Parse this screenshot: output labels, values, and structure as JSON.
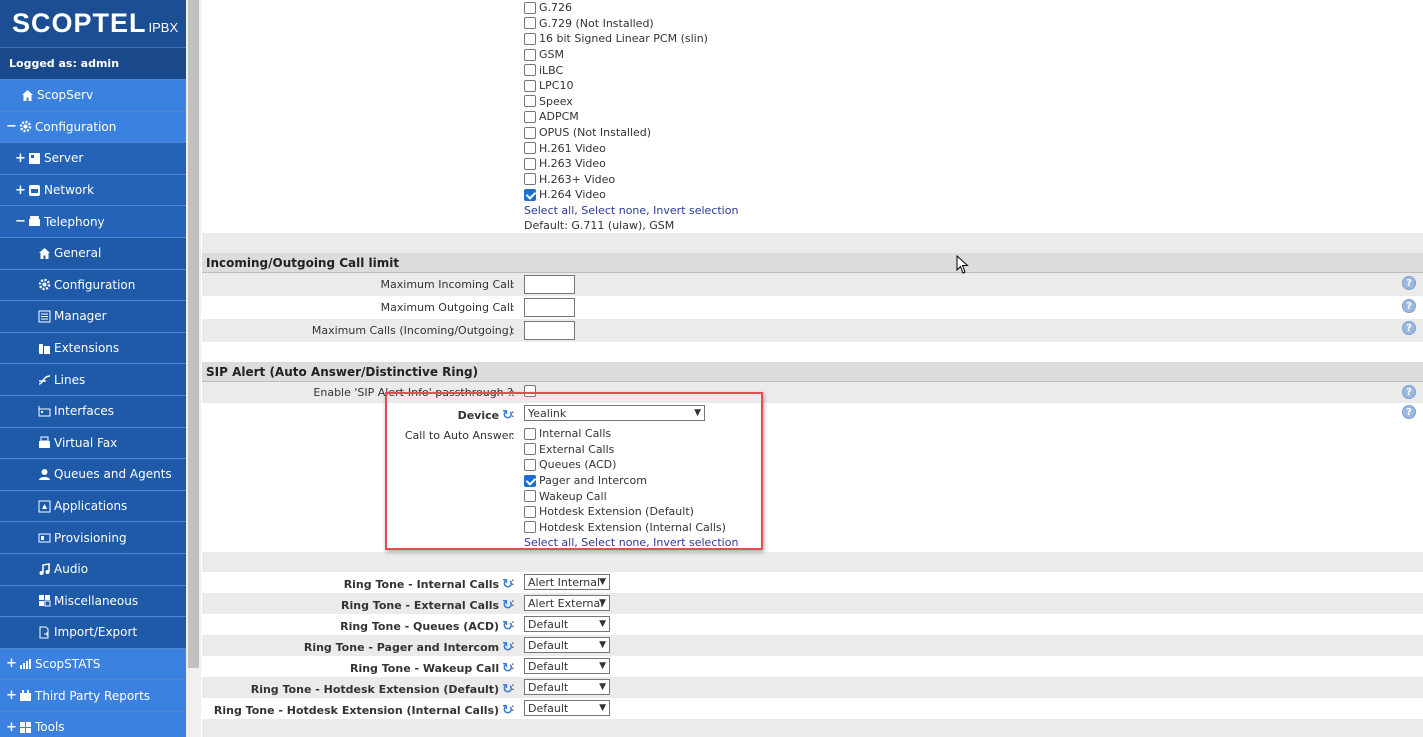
{
  "brand": {
    "logo": "SCOPTEL",
    "suffix": "IPBX"
  },
  "logged_as": "Logged as: admin",
  "nav": {
    "scopserv": "ScopServ",
    "configuration": "Configuration",
    "server": "Server",
    "network": "Network",
    "telephony": "Telephony",
    "general": "General",
    "configuration2": "Configuration",
    "manager": "Manager",
    "extensions": "Extensions",
    "lines": "Lines",
    "interfaces": "Interfaces",
    "virtual_fax": "Virtual Fax",
    "queues_agents": "Queues and Agents",
    "applications": "Applications",
    "provisioning": "Provisioning",
    "audio": "Audio",
    "miscellaneous": "Miscellaneous",
    "import_export": "Import/Export",
    "scopstats": "ScopSTATS",
    "third_party": "Third Party Reports",
    "tools": "Tools"
  },
  "codecs": {
    "items": [
      {
        "label": "G.726",
        "checked": false
      },
      {
        "label": "G.729 (Not Installed)",
        "checked": false
      },
      {
        "label": "16 bit Signed Linear PCM (slin)",
        "checked": false
      },
      {
        "label": "GSM",
        "checked": false
      },
      {
        "label": "iLBC",
        "checked": false
      },
      {
        "label": "LPC10",
        "checked": false
      },
      {
        "label": "Speex",
        "checked": false
      },
      {
        "label": "ADPCM",
        "checked": false
      },
      {
        "label": "OPUS (Not Installed)",
        "checked": false
      },
      {
        "label": "H.261 Video",
        "checked": false
      },
      {
        "label": "H.263 Video",
        "checked": false
      },
      {
        "label": "H.263+ Video",
        "checked": false
      },
      {
        "label": "H.264 Video",
        "checked": true
      }
    ],
    "select_all": "Select all",
    "select_none": "Select none",
    "invert": "Invert selection",
    "default_text": "Default: G.711 (ulaw), GSM"
  },
  "call_limit": {
    "header": "Incoming/Outgoing Call limit",
    "max_incoming": "Maximum Incoming Call",
    "max_outgoing": "Maximum Outgoing Call",
    "max_calls": "Maximum Calls (Incoming/Outgoing)"
  },
  "sip_alert": {
    "header": "SIP Alert (Auto Answer/Distinctive Ring)",
    "enable_label": "Enable 'SIP Alert-Info' passthrough ?",
    "device_label": "Device",
    "device_value": "Yealink",
    "auto_answer_label": "Call to Auto Answer",
    "auto_answer_items": [
      {
        "label": "Internal Calls",
        "checked": false
      },
      {
        "label": "External Calls",
        "checked": false
      },
      {
        "label": "Queues (ACD)",
        "checked": false
      },
      {
        "label": "Pager and Intercom",
        "checked": true
      },
      {
        "label": "Wakeup Call",
        "checked": false
      },
      {
        "label": "Hotdesk Extension (Default)",
        "checked": false
      },
      {
        "label": "Hotdesk Extension (Internal Calls)",
        "checked": false
      }
    ]
  },
  "ringtones": [
    {
      "label": "Ring Tone - Internal Calls",
      "value": "Alert Internal"
    },
    {
      "label": "Ring Tone - External Calls",
      "value": "Alert External"
    },
    {
      "label": "Ring Tone - Queues (ACD)",
      "value": "Default"
    },
    {
      "label": "Ring Tone - Pager and Intercom",
      "value": "Default"
    },
    {
      "label": "Ring Tone - Wakeup Call",
      "value": "Default"
    },
    {
      "label": "Ring Tone - Hotdesk Extension (Default)",
      "value": "Default"
    },
    {
      "label": "Ring Tone - Hotdesk Extension (Internal Calls)",
      "value": "Default"
    }
  ],
  "colors": {
    "sidebar": "#1e5aa8",
    "sidebar_top": "#3b82e0",
    "highlight_box": "#e05050"
  },
  "help_glyph": "?",
  "colon": ":"
}
